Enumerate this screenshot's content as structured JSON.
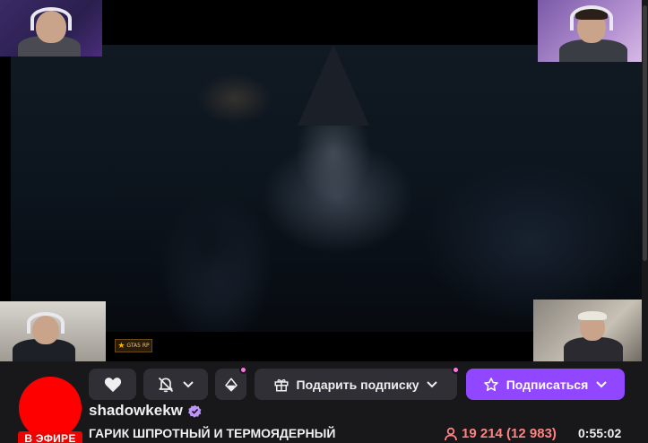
{
  "player": {
    "ad_badge_text": "GTA5 RP"
  },
  "channel": {
    "name": "shadowkekw",
    "live_label": "В ЭФИРЕ",
    "stream_title": "ГАРИК ШПРОТНЫЙ И ТЕРМОЯДЕРНЫЙ",
    "viewers": "19 214 (12 983)",
    "uptime": "0:55:02"
  },
  "actions": {
    "gift_label": "Подарить подписку",
    "subscribe_label": "Подписаться"
  },
  "colors": {
    "accent": "#9147ff",
    "live": "#eb0400",
    "viewers": "#ff8280",
    "notification_dot": "#ff75e6",
    "avatar": "#ff0000"
  }
}
